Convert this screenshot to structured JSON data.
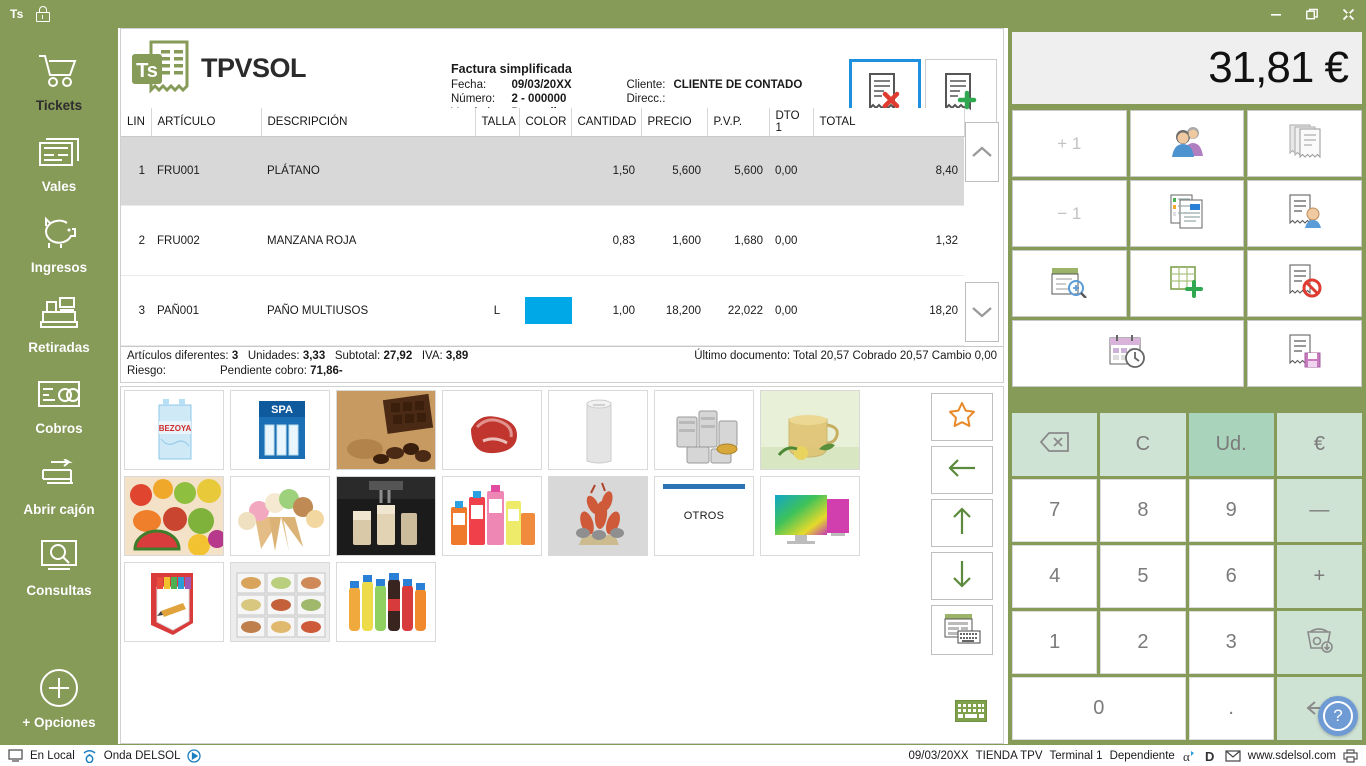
{
  "titlebar": {
    "app_abbr": "Ts",
    "lock_icon": "lock-icon",
    "minimize": "—",
    "restore": "❐",
    "close": "✕"
  },
  "sidebar": {
    "items": [
      {
        "label": "Tickets",
        "icon": "shopping-cart-icon",
        "active": true
      },
      {
        "label": "Vales",
        "icon": "vouchers-icon",
        "active": false
      },
      {
        "label": "Ingresos",
        "icon": "piggy-bank-icon",
        "active": false
      },
      {
        "label": "Retiradas",
        "icon": "cash-register-icon",
        "active": false
      },
      {
        "label": "Cobros",
        "icon": "card-payment-icon",
        "active": false
      },
      {
        "label": "Abrir cajón",
        "icon": "open-drawer-icon",
        "active": false
      },
      {
        "label": "Consultas",
        "icon": "search-screen-icon",
        "active": false
      },
      {
        "label": "+ Opciones",
        "icon": "plus-circle-icon",
        "active": false
      }
    ]
  },
  "document": {
    "brand": "TPVSOL",
    "title": "Factura simplificada",
    "fields": {
      "fecha_label": "Fecha:",
      "fecha_value": "09/03/20XX",
      "numero_label": "Número:",
      "numero_value": "2 - 000000",
      "vendedor_label": "Vendedor:",
      "vendedor_value": "Dependiente",
      "cliente_label": "Cliente:",
      "cliente_value": "CLIENTE DE CONTADO",
      "direcc_label": "Direcc.:",
      "direcc_value": ""
    },
    "actions": [
      {
        "name": "delete-document-button",
        "icon": "receipt-delete-icon",
        "focused": true
      },
      {
        "name": "new-document-button",
        "icon": "receipt-add-icon",
        "focused": false
      }
    ]
  },
  "lines_table": {
    "columns": [
      "LIN",
      "ARTÍCULO",
      "DESCRIPCIÓN",
      "TALLA",
      "COLOR",
      "CANTIDAD",
      "PRECIO",
      "P.V.P.",
      "DTO 1",
      "TOTAL"
    ],
    "rows": [
      {
        "lin": "1",
        "articulo": "FRU001",
        "descripcion": "PLÁTANO",
        "talla": "",
        "color": "",
        "cantidad": "1,50",
        "precio": "5,600",
        "pvp": "5,600",
        "dto1": "0,00",
        "total": "8,40",
        "selected": true
      },
      {
        "lin": "2",
        "articulo": "FRU002",
        "descripcion": "MANZANA ROJA",
        "talla": "",
        "color": "",
        "cantidad": "0,83",
        "precio": "1,600",
        "pvp": "1,680",
        "dto1": "0,00",
        "total": "1,32",
        "selected": false
      },
      {
        "lin": "3",
        "articulo": "PAÑ001",
        "descripcion": "PAÑO MULTIUSOS",
        "talla": "L",
        "color": "#00a8e8",
        "cantidad": "1,00",
        "precio": "18,200",
        "pvp": "22,022",
        "dto1": "0,00",
        "total": "18,20",
        "selected": false
      }
    ],
    "scroll_up": "chevron-up-icon",
    "scroll_down": "chevron-down-icon"
  },
  "totals": {
    "articulos_label": "Artículos diferentes:",
    "articulos_value": "3",
    "unidades_label": "Unidades:",
    "unidades_value": "3,33",
    "subtotal_label": "Subtotal:",
    "subtotal_value": "27,92",
    "iva_label": "IVA:",
    "iva_value": "3,89",
    "riesgo_label": "Riesgo:",
    "riesgo_value": "",
    "pendiente_label": "Pendiente cobro:",
    "pendiente_value": "71,86-",
    "ultimo_documento": "Último documento: Total 20,57 Cobrado 20,57 Cambio 0,00"
  },
  "products": {
    "tiles": [
      {
        "name": "product-water-bezoya",
        "icon": "water-pack-image",
        "label": ""
      },
      {
        "name": "product-spa-bottles",
        "icon": "spa-box-image",
        "label": ""
      },
      {
        "name": "product-chocolate",
        "icon": "chocolate-image",
        "label": ""
      },
      {
        "name": "product-meat",
        "icon": "meat-image",
        "label": ""
      },
      {
        "name": "product-paper-roll",
        "icon": "paper-roll-image",
        "label": ""
      },
      {
        "name": "product-canned-goods",
        "icon": "cans-image",
        "label": ""
      },
      {
        "name": "product-tea",
        "icon": "tea-glass-image",
        "label": ""
      },
      {
        "name": "product-fruit",
        "icon": "fruits-image",
        "label": ""
      },
      {
        "name": "product-icecream",
        "icon": "icecream-image",
        "label": ""
      },
      {
        "name": "product-coffee",
        "icon": "coffee-image",
        "label": ""
      },
      {
        "name": "product-cleaning",
        "icon": "cleaning-image",
        "label": ""
      },
      {
        "name": "product-seafood",
        "icon": "seafood-image",
        "label": ""
      },
      {
        "name": "product-otros",
        "icon": "",
        "label": "OTROS"
      },
      {
        "name": "product-television",
        "icon": "tv-image",
        "label": ""
      },
      {
        "name": "product-stationery",
        "icon": "stationery-image",
        "label": ""
      },
      {
        "name": "product-catering",
        "icon": "catering-image",
        "label": ""
      },
      {
        "name": "product-softdrinks",
        "icon": "softdrinks-image",
        "label": ""
      }
    ],
    "nav": [
      {
        "name": "favorites-button",
        "icon": "star-icon"
      },
      {
        "name": "back-button",
        "icon": "arrow-left-icon"
      },
      {
        "name": "scroll-up-button",
        "icon": "arrow-up-icon"
      },
      {
        "name": "scroll-down-button",
        "icon": "arrow-down-icon"
      },
      {
        "name": "keyboard-entry-button",
        "icon": "screen-keyboard-icon"
      }
    ],
    "bottom_keyboard": "keyboard-icon"
  },
  "right_panel": {
    "total_amount": "31,81 €",
    "function_keys": [
      {
        "name": "increment-button",
        "label": "+ 1",
        "icon": "",
        "disabled": true
      },
      {
        "name": "customer-button",
        "label": "",
        "icon": "customers-icon",
        "disabled": false
      },
      {
        "name": "documents-list-button",
        "label": "",
        "icon": "receipts-stack-icon",
        "disabled": false
      },
      {
        "name": "decrement-button",
        "label": "− 1",
        "icon": "",
        "disabled": true
      },
      {
        "name": "articles-button",
        "label": "",
        "icon": "articles-icon",
        "disabled": false
      },
      {
        "name": "customer-receipt-button",
        "label": "",
        "icon": "receipt-customer-icon",
        "disabled": false
      },
      {
        "name": "search-document-button",
        "label": "",
        "icon": "document-search-icon",
        "disabled": false
      },
      {
        "name": "new-line-button",
        "label": "",
        "icon": "table-add-icon",
        "disabled": false
      },
      {
        "name": "cancel-receipt-button",
        "label": "",
        "icon": "receipt-cancel-icon",
        "disabled": false
      },
      {
        "name": "pending-button",
        "label": "",
        "icon": "calendar-clock-icon",
        "disabled": false
      },
      {
        "name": "save-receipt-button",
        "label": "",
        "icon": "receipt-save-icon",
        "disabled": false
      }
    ],
    "keypad": [
      {
        "name": "backspace-key",
        "label": "",
        "icon": "backspace-icon",
        "style": "tint"
      },
      {
        "name": "clear-key",
        "label": "C",
        "icon": "",
        "style": "tint"
      },
      {
        "name": "units-key",
        "label": "Ud.",
        "icon": "",
        "style": "tint2"
      },
      {
        "name": "euro-key",
        "label": "€",
        "icon": "",
        "style": "tint"
      },
      {
        "name": "key-7",
        "label": "7",
        "icon": "",
        "style": ""
      },
      {
        "name": "key-8",
        "label": "8",
        "icon": "",
        "style": ""
      },
      {
        "name": "key-9",
        "label": "9",
        "icon": "",
        "style": ""
      },
      {
        "name": "minus-key",
        "label": "—",
        "icon": "",
        "style": "tint"
      },
      {
        "name": "key-4",
        "label": "4",
        "icon": "",
        "style": ""
      },
      {
        "name": "key-5",
        "label": "5",
        "icon": "",
        "style": ""
      },
      {
        "name": "key-6",
        "label": "6",
        "icon": "",
        "style": ""
      },
      {
        "name": "plus-key",
        "label": "+",
        "icon": "",
        "style": "tint"
      },
      {
        "name": "key-1",
        "label": "1",
        "icon": "",
        "style": ""
      },
      {
        "name": "key-2",
        "label": "2",
        "icon": "",
        "style": ""
      },
      {
        "name": "key-3",
        "label": "3",
        "icon": "",
        "style": ""
      },
      {
        "name": "scale-key",
        "label": "",
        "icon": "scale-icon",
        "style": "tint"
      },
      {
        "name": "key-0",
        "label": "0",
        "icon": "",
        "style": "wide2"
      },
      {
        "name": "decimal-key",
        "label": ".",
        "icon": "",
        "style": ""
      },
      {
        "name": "enter-key",
        "label": "",
        "icon": "enter-icon",
        "style": "tint"
      }
    ],
    "help": "?"
  },
  "statusbar": {
    "local_label": "En Local",
    "local_icon": "monitor-icon",
    "radio_label": "Onda DELSOL",
    "radio_icon": "radio-icon",
    "play_icon": "play-icon",
    "date": "09/03/20XX",
    "store": "TIENDA TPV",
    "terminal": "Terminal 1",
    "user": "Dependiente",
    "alpha_icon": "alpha-icon",
    "d_icon": "d-icon",
    "mail_icon": "mail-icon",
    "website": "www.sdelsol.com",
    "print_icon": "printer-icon"
  },
  "colors": {
    "brand_green": "#879B58",
    "accent_blue": "#00a8e8",
    "focus_blue": "#1e90e0",
    "keypad_tint": "#cfe3d5",
    "keypad_tint_active": "#a9d3ba",
    "selected_row": "#d8d8d8"
  }
}
